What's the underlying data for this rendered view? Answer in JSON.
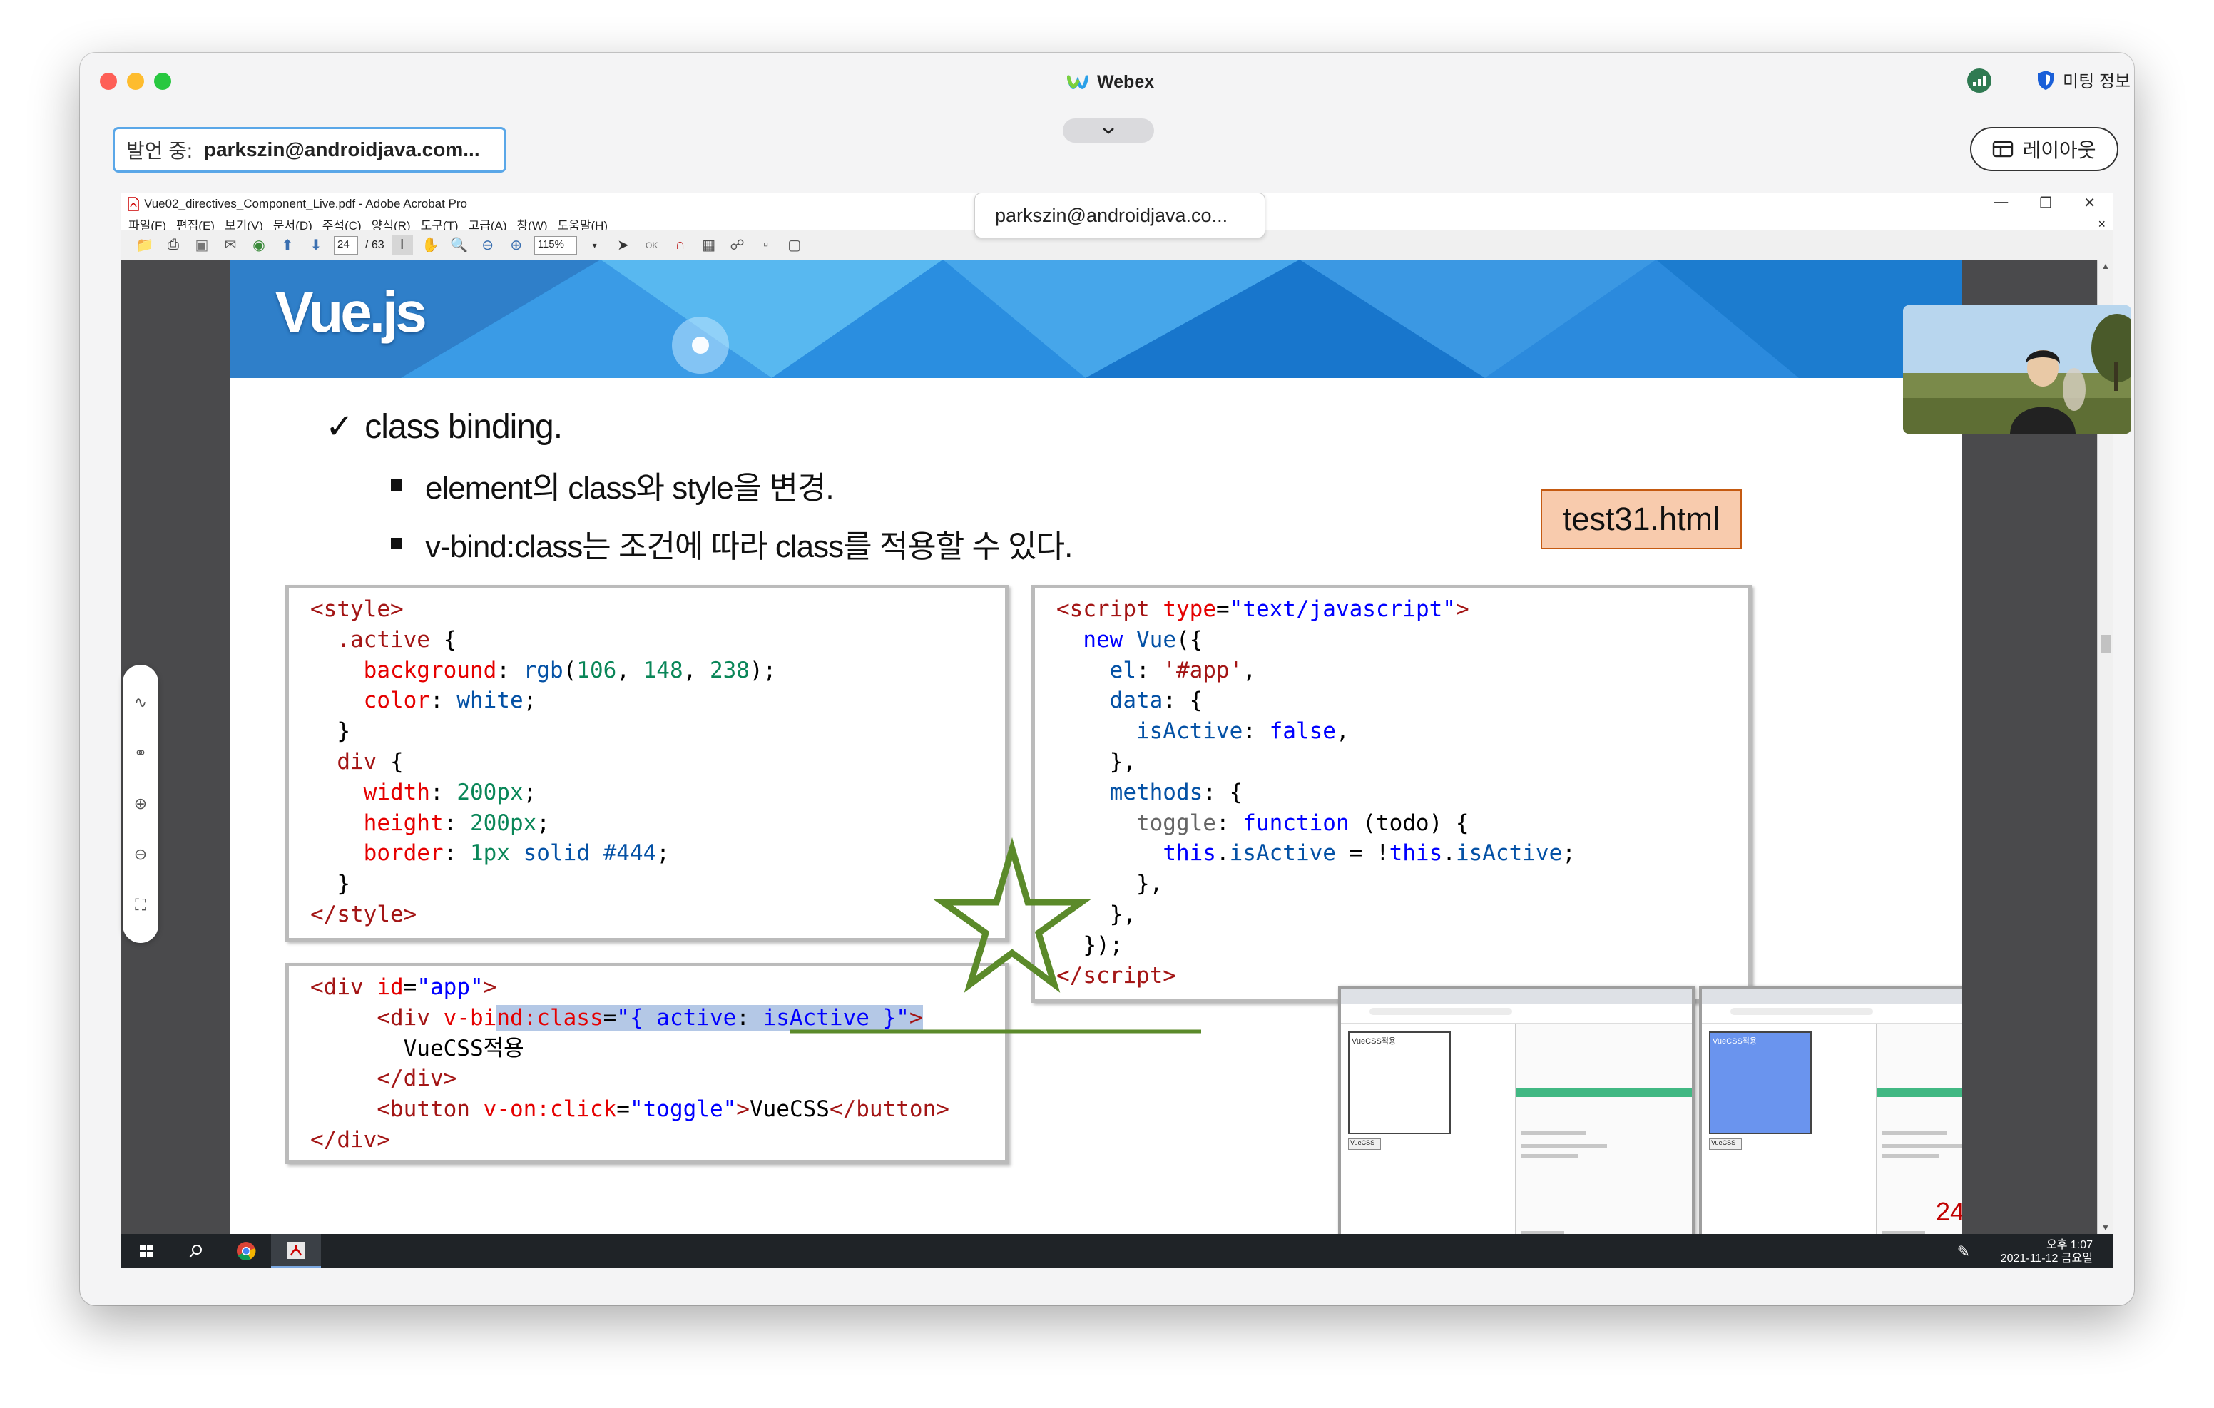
{
  "window": {
    "title": "Webex"
  },
  "presenter": {
    "label": "발언 중:",
    "name": "parkszin@androidjava.com..."
  },
  "meeting_info": "미팅 정보",
  "layout_button": "레이아웃",
  "share_name_label": "parkszin@androidjava.co...",
  "acrobat": {
    "title": "Vue02_directives_Component_Live.pdf - Adobe Acrobat Pro",
    "menu": [
      "파일(F)",
      "편집(E)",
      "보기(V)",
      "문서(D)",
      "주석(C)",
      "양식(R)",
      "도구(T)",
      "고급(A)",
      "창(W)",
      "도움말(H)"
    ],
    "page_current": "24",
    "page_total": "/ 63",
    "zoom": "115%"
  },
  "slide": {
    "logo": "Vue.js",
    "heading": "class binding.",
    "bullets": [
      "element의 class와 style을 변경.",
      "v-bind:class는 조건에 따라 class를 적용할 수 있다."
    ],
    "file_label": "test31.html",
    "page_number": "24",
    "shot_left": {
      "demo_text": "VueCSS적용",
      "button": "VueCSS"
    },
    "shot_right": {
      "demo_text": "VueCSS적용",
      "button": "VueCSS"
    }
  },
  "taskbar": {
    "time": "오후 1:07",
    "date": "2021-11-12 금요일"
  },
  "colors": {
    "banner": "#1b7fd4",
    "vue_green": "#41b883",
    "star": "#5b8a2a",
    "page_number": "#c00000"
  }
}
